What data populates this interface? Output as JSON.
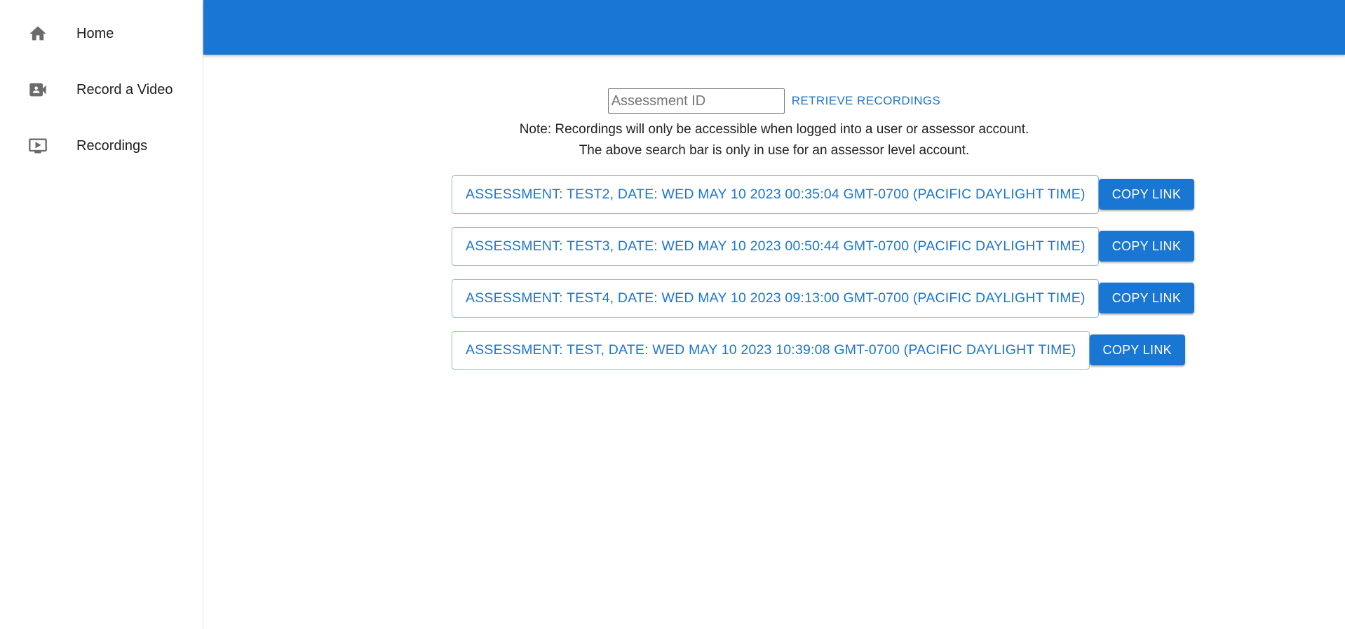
{
  "sidebar": {
    "items": [
      {
        "label": "Home",
        "icon": "home-icon"
      },
      {
        "label": "Record a Video",
        "icon": "video-camera-icon"
      },
      {
        "label": "Recordings",
        "icon": "play-screen-icon"
      }
    ]
  },
  "search": {
    "placeholder": "Assessment ID",
    "value": "",
    "button_label": "RETRIEVE RECORDINGS"
  },
  "note": {
    "line1": "Note: Recordings will only be accessible when logged into a user or assessor account.",
    "line2": "The above search bar is only in use for an assessor level account."
  },
  "recordings": [
    {
      "label": "ASSESSMENT: TEST2, DATE: WED MAY 10 2023 00:35:04 GMT-0700 (PACIFIC DAYLIGHT TIME)",
      "button": "COPY LINK"
    },
    {
      "label": "ASSESSMENT: TEST3, DATE: WED MAY 10 2023 00:50:44 GMT-0700 (PACIFIC DAYLIGHT TIME)",
      "button": "COPY LINK"
    },
    {
      "label": "ASSESSMENT: TEST4, DATE: WED MAY 10 2023 09:13:00 GMT-0700 (PACIFIC DAYLIGHT TIME)",
      "button": "COPY LINK"
    },
    {
      "label": "ASSESSMENT: TEST, DATE: WED MAY 10 2023 10:39:08 GMT-0700 (PACIFIC DAYLIGHT TIME)",
      "button": "COPY LINK"
    }
  ],
  "colors": {
    "primary": "#1976d2",
    "icon_gray": "#6b6b6b"
  }
}
